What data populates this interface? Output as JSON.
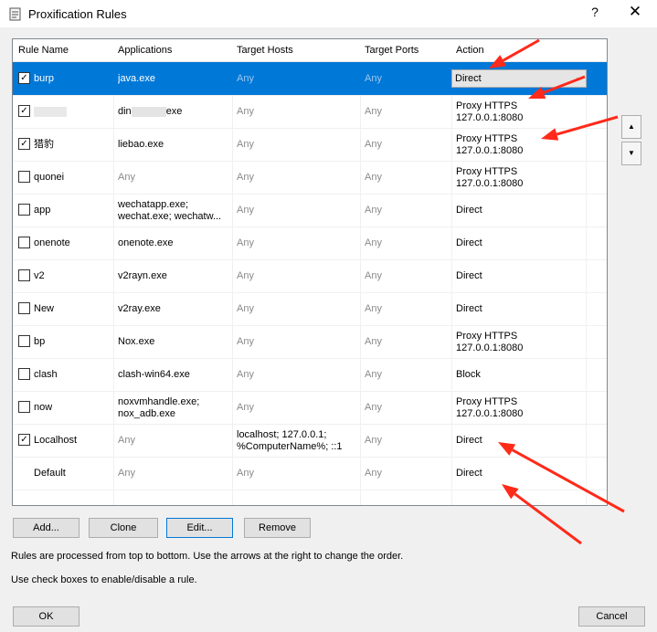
{
  "window": {
    "title": "Proxification Rules",
    "help": "?",
    "close": "✕"
  },
  "columns": [
    "Rule Name",
    "Applications",
    "Target Hosts",
    "Target Ports",
    "Action"
  ],
  "rules": [
    {
      "checked": true,
      "name": "burp",
      "apps": [
        "java.exe"
      ],
      "hosts": [
        "Any"
      ],
      "ports": "Any",
      "action": [
        "Direct"
      ],
      "selected": true
    },
    {
      "checked": true,
      "name": "",
      "apps": [
        "din",
        "exe"
      ],
      "hosts": [
        "Any"
      ],
      "ports": "Any",
      "action": [
        "Proxy HTTPS",
        "127.0.0.1:8080"
      ]
    },
    {
      "checked": true,
      "name": "猎豹",
      "apps": [
        "liebao.exe"
      ],
      "hosts": [
        "Any"
      ],
      "ports": "Any",
      "action": [
        "Proxy HTTPS",
        "127.0.0.1:8080"
      ]
    },
    {
      "checked": false,
      "name": "quonei",
      "apps": [
        "Any"
      ],
      "hosts": [
        "Any"
      ],
      "ports": "Any",
      "action": [
        "Proxy HTTPS",
        "127.0.0.1:8080"
      ]
    },
    {
      "checked": false,
      "name": "app",
      "apps": [
        "wechatapp.exe;",
        "wechat.exe; wechatw..."
      ],
      "hosts": [
        "Any"
      ],
      "ports": "Any",
      "action": [
        "Direct"
      ]
    },
    {
      "checked": false,
      "name": "onenote",
      "apps": [
        "onenote.exe"
      ],
      "hosts": [
        "Any"
      ],
      "ports": "Any",
      "action": [
        "Direct"
      ]
    },
    {
      "checked": false,
      "name": "v2",
      "apps": [
        "v2rayn.exe"
      ],
      "hosts": [
        "Any"
      ],
      "ports": "Any",
      "action": [
        "Direct"
      ]
    },
    {
      "checked": false,
      "name": "New",
      "apps": [
        "v2ray.exe"
      ],
      "hosts": [
        "Any"
      ],
      "ports": "Any",
      "action": [
        "Direct"
      ]
    },
    {
      "checked": false,
      "name": "bp",
      "apps": [
        "Nox.exe"
      ],
      "hosts": [
        "Any"
      ],
      "ports": "Any",
      "action": [
        "Proxy HTTPS",
        "127.0.0.1:8080"
      ]
    },
    {
      "checked": false,
      "name": "clash",
      "apps": [
        "clash-win64.exe"
      ],
      "hosts": [
        "Any"
      ],
      "ports": "Any",
      "action": [
        "Block"
      ]
    },
    {
      "checked": false,
      "name": "now",
      "apps": [
        "noxvmhandle.exe;",
        "nox_adb.exe"
      ],
      "hosts": [
        "Any"
      ],
      "ports": "Any",
      "action": [
        "Proxy HTTPS",
        "127.0.0.1:8080"
      ]
    },
    {
      "checked": true,
      "name": "Localhost",
      "apps": [
        "Any"
      ],
      "hosts": [
        "localhost; 127.0.0.1;",
        "%ComputerName%; ::1"
      ],
      "ports": "Any",
      "action": [
        "Direct"
      ]
    },
    {
      "checked": null,
      "name": "Default",
      "apps": [
        "Any"
      ],
      "hosts": [
        "Any"
      ],
      "ports": "Any",
      "action": [
        "Direct"
      ]
    }
  ],
  "buttons": {
    "add": "Add...",
    "clone": "Clone",
    "edit": "Edit...",
    "remove": "Remove",
    "ok": "OK",
    "cancel": "Cancel"
  },
  "order_buttons": {
    "up": "▲",
    "down": "▼"
  },
  "info": {
    "line1": "Rules are processed from top to bottom. Use the arrows at the right to change the order.",
    "line2": "Use check boxes to enable/disable a rule."
  },
  "colors": {
    "selection": "#0078d7",
    "annotation_arrow": "#ff2a1a"
  }
}
